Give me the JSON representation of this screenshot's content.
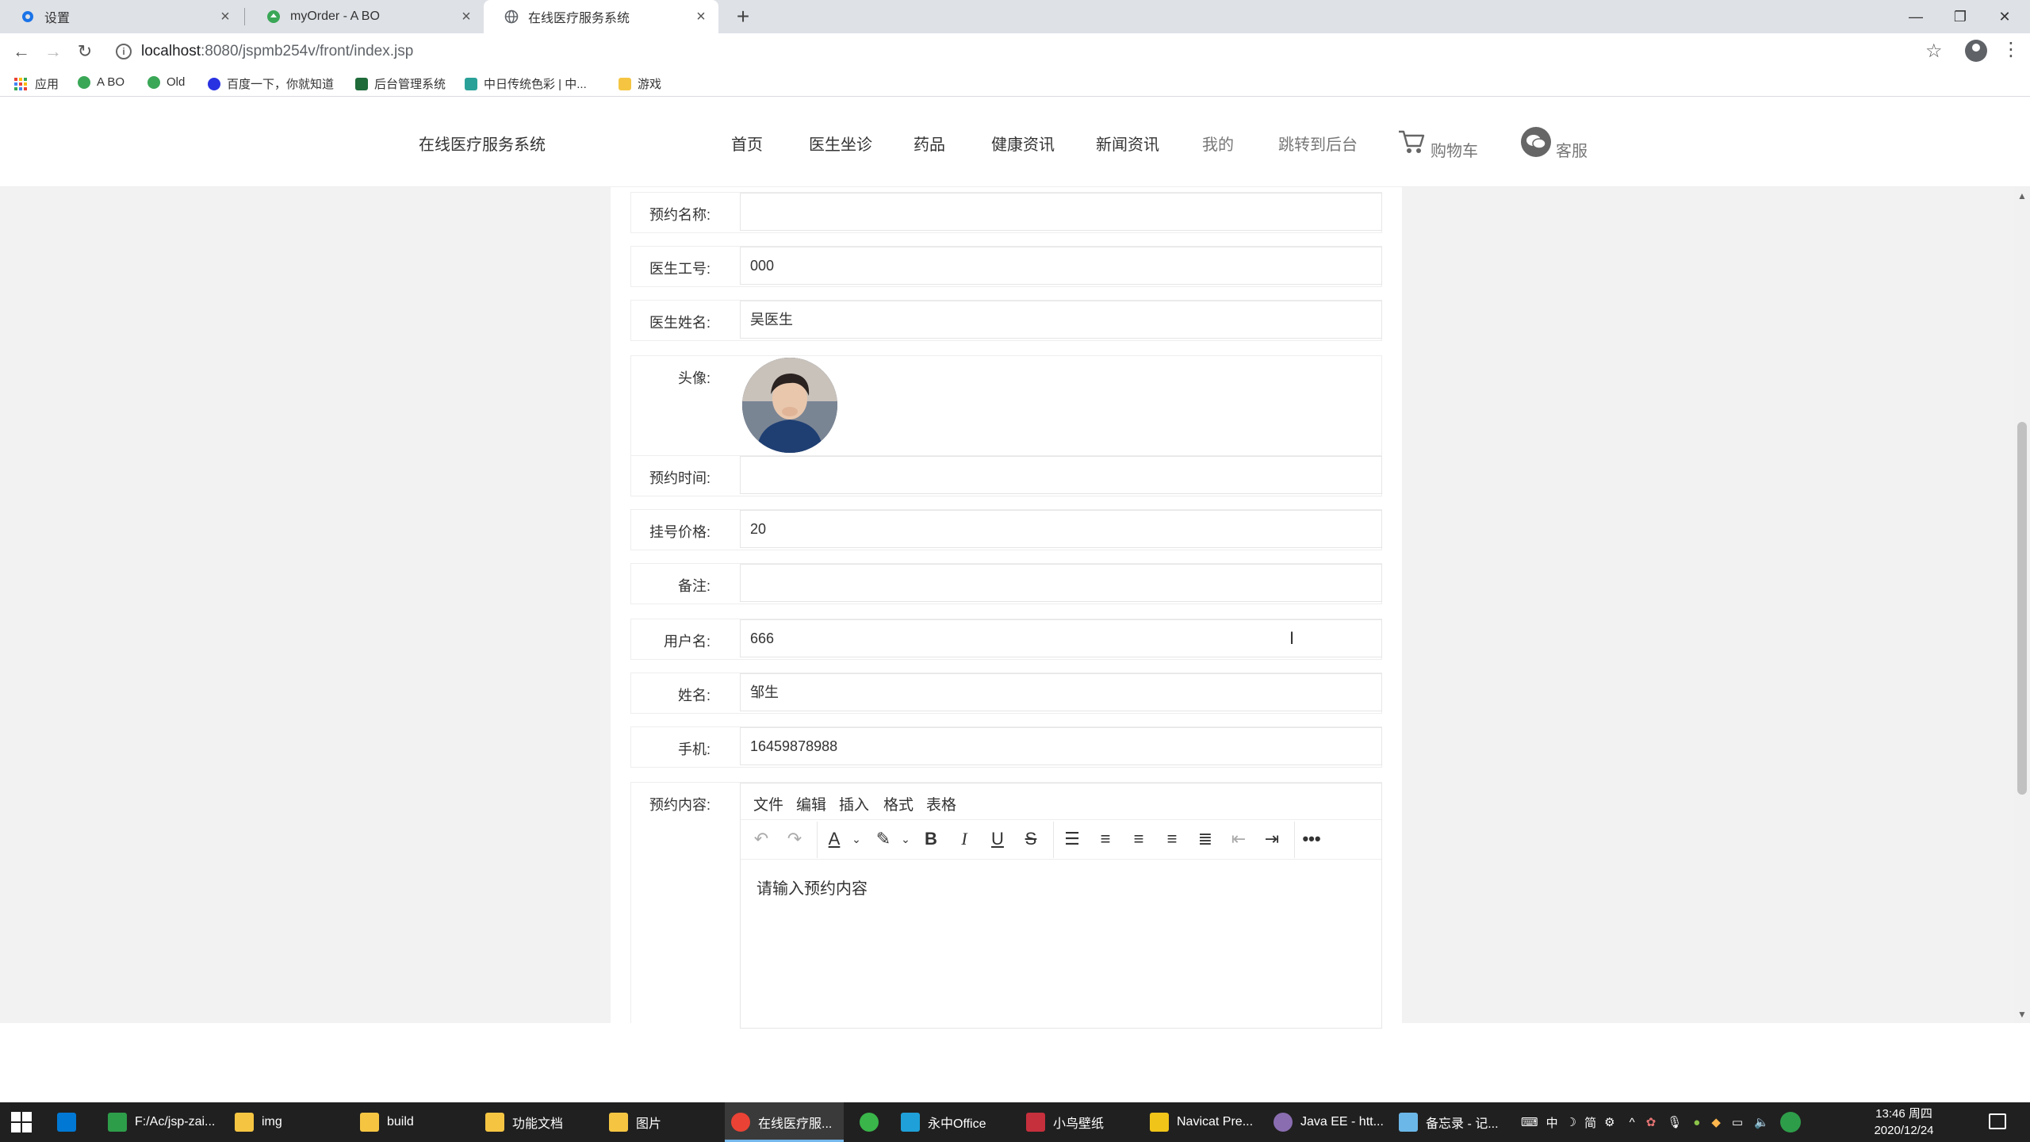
{
  "browser": {
    "tabs": [
      {
        "title": "设置",
        "icon": "gear-icon"
      },
      {
        "title": "myOrder - A BO",
        "icon": "site-icon"
      },
      {
        "title": "在线医疗服务系统",
        "icon": "globe-icon"
      }
    ],
    "url_host": "localhost",
    "url_path": ":8080/jspmb254v/front/index.jsp",
    "bookmarks": [
      "应用",
      "A BO",
      "Old",
      "百度一下，你就知道",
      "后台管理系统",
      "中日传统色彩 | 中...",
      "游戏"
    ]
  },
  "site": {
    "title": "在线医疗服务系统",
    "menu": [
      "首页",
      "医生坐诊",
      "药品",
      "健康资讯",
      "新闻资讯",
      "我的",
      "跳转到后台"
    ],
    "cart_label": "购物车",
    "service_label": "客服"
  },
  "form": {
    "fields": [
      {
        "label": "预约名称:",
        "value": ""
      },
      {
        "label": "医生工号:",
        "value": "000"
      },
      {
        "label": "医生姓名:",
        "value": "吴医生"
      },
      {
        "label": "头像:",
        "value": ""
      },
      {
        "label": "预约时间:",
        "value": ""
      },
      {
        "label": "挂号价格:",
        "value": "20"
      },
      {
        "label": "备注:",
        "value": ""
      },
      {
        "label": "用户名:",
        "value": "666"
      },
      {
        "label": "姓名:",
        "value": "邹生"
      },
      {
        "label": "手机:",
        "value": "16459878988"
      },
      {
        "label": "预约内容:",
        "value": ""
      }
    ],
    "editor": {
      "menus": [
        "文件",
        "编辑",
        "插入",
        "格式",
        "表格"
      ],
      "placeholder": "请输入预约内容"
    }
  },
  "taskbar": {
    "items": [
      "F:/Ac/jsp-zai...",
      "img",
      "build",
      "功能文档",
      "图片",
      "在线医疗服...",
      "",
      "永中Office",
      "小鸟壁纸",
      "Navicat Pre...",
      "Java EE - htt...",
      "备忘录 - 记..."
    ],
    "tray_text": "中",
    "tray_text2": "简",
    "time": "13:46 周四",
    "date": "2020/12/24"
  },
  "colors": {
    "taskbar_bg": "#202020",
    "page_bg": "#f2f2f2",
    "tab_bar": "#dee1e6"
  }
}
